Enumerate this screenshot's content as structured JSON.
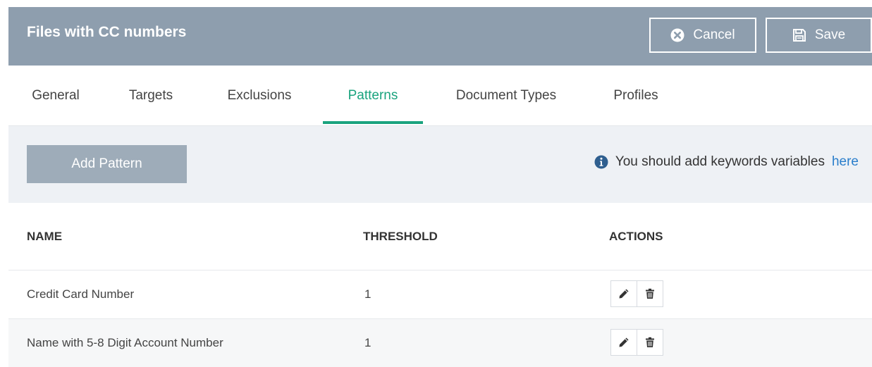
{
  "header": {
    "title": "Files with CC numbers",
    "cancel_label": "Cancel",
    "save_label": "Save",
    "background_color": "#8e9eae"
  },
  "tabs": [
    {
      "label": "General",
      "active": false
    },
    {
      "label": "Targets",
      "active": false
    },
    {
      "label": "Exclusions",
      "active": false
    },
    {
      "label": "Patterns",
      "active": true
    },
    {
      "label": "Document Types",
      "active": false
    },
    {
      "label": "Profiles",
      "active": false
    }
  ],
  "toolbar": {
    "add_pattern_label": "Add Pattern",
    "info_text": "You should add keywords variables",
    "info_link": "here"
  },
  "table": {
    "columns": [
      "NAME",
      "THRESHOLD",
      "ACTIONS"
    ],
    "rows": [
      {
        "name": "Credit Card Number",
        "threshold": "1",
        "actions": [
          "edit-icon",
          "trash-icon"
        ]
      },
      {
        "name": "Name with 5-8 Digit Account Number",
        "threshold": "1",
        "actions": [
          "edit-icon",
          "trash-icon"
        ]
      }
    ]
  },
  "colors": {
    "accent": "#1aa37e",
    "link": "#2a7ecb",
    "button_gray": "#9eacb9"
  }
}
